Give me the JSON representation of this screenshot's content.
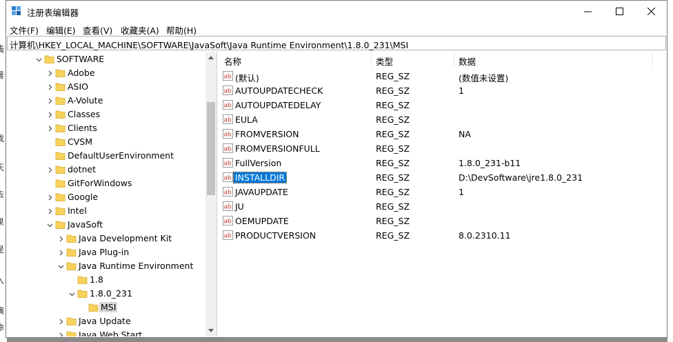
{
  "window": {
    "title": "注册表编辑器"
  },
  "menu": [
    "文件(F)",
    "编辑(E)",
    "查看(V)",
    "收藏夹(A)",
    "帮助(H)"
  ],
  "address": "计算机\\HKEY_LOCAL_MACHINE\\SOFTWARE\\JavaSoft\\Java Runtime Environment\\1.8.0_231\\MSI",
  "tree": [
    {
      "label": "SOFTWARE",
      "depth": 0,
      "state": "expanded"
    },
    {
      "label": "Adobe",
      "depth": 1,
      "state": "collapsed"
    },
    {
      "label": "ASIO",
      "depth": 1,
      "state": "collapsed"
    },
    {
      "label": "A-Volute",
      "depth": 1,
      "state": "collapsed"
    },
    {
      "label": "Classes",
      "depth": 1,
      "state": "collapsed"
    },
    {
      "label": "Clients",
      "depth": 1,
      "state": "collapsed"
    },
    {
      "label": "CVSM",
      "depth": 1,
      "state": "none"
    },
    {
      "label": "DefaultUserEnvironment",
      "depth": 1,
      "state": "none"
    },
    {
      "label": "dotnet",
      "depth": 1,
      "state": "collapsed"
    },
    {
      "label": "GitForWindows",
      "depth": 1,
      "state": "none"
    },
    {
      "label": "Google",
      "depth": 1,
      "state": "collapsed"
    },
    {
      "label": "Intel",
      "depth": 1,
      "state": "collapsed"
    },
    {
      "label": "JavaSoft",
      "depth": 1,
      "state": "expanded"
    },
    {
      "label": "Java Development Kit",
      "depth": 2,
      "state": "collapsed"
    },
    {
      "label": "Java Plug-in",
      "depth": 2,
      "state": "collapsed"
    },
    {
      "label": "Java Runtime Environment",
      "depth": 2,
      "state": "expanded"
    },
    {
      "label": "1.8",
      "depth": 3,
      "state": "none"
    },
    {
      "label": "1.8.0_231",
      "depth": 3,
      "state": "expanded"
    },
    {
      "label": "MSI",
      "depth": 4,
      "state": "none",
      "selected": true
    },
    {
      "label": "Java Update",
      "depth": 2,
      "state": "collapsed"
    },
    {
      "label": "Java Web Start",
      "depth": 2,
      "state": "collapsed"
    }
  ],
  "columns": {
    "name": "名称",
    "type": "类型",
    "data": "数据"
  },
  "values": [
    {
      "name": "(默认)",
      "type": "REG_SZ",
      "data": "(数值未设置)"
    },
    {
      "name": "AUTOUPDATECHECK",
      "type": "REG_SZ",
      "data": "1"
    },
    {
      "name": "AUTOUPDATEDELAY",
      "type": "REG_SZ",
      "data": ""
    },
    {
      "name": "EULA",
      "type": "REG_SZ",
      "data": ""
    },
    {
      "name": "FROMVERSION",
      "type": "REG_SZ",
      "data": "NA"
    },
    {
      "name": "FROMVERSIONFULL",
      "type": "REG_SZ",
      "data": ""
    },
    {
      "name": "FullVersion",
      "type": "REG_SZ",
      "data": "1.8.0_231-b11"
    },
    {
      "name": "INSTALLDIR",
      "type": "REG_SZ",
      "data": "D:\\DevSoftware\\jre1.8.0_231",
      "selected": true
    },
    {
      "name": "JAVAUPDATE",
      "type": "REG_SZ",
      "data": "1"
    },
    {
      "name": "JU",
      "type": "REG_SZ",
      "data": ""
    },
    {
      "name": "OEMUPDATE",
      "type": "REG_SZ",
      "data": ""
    },
    {
      "name": "PRODUCTVERSION",
      "type": "REG_SZ",
      "data": "8.0.2310.11"
    }
  ],
  "background_fragments": [
    "浅",
    "著",
    "找",
    "天",
    "去",
    "果",
    "是",
    "入",
    "演",
    "命"
  ]
}
